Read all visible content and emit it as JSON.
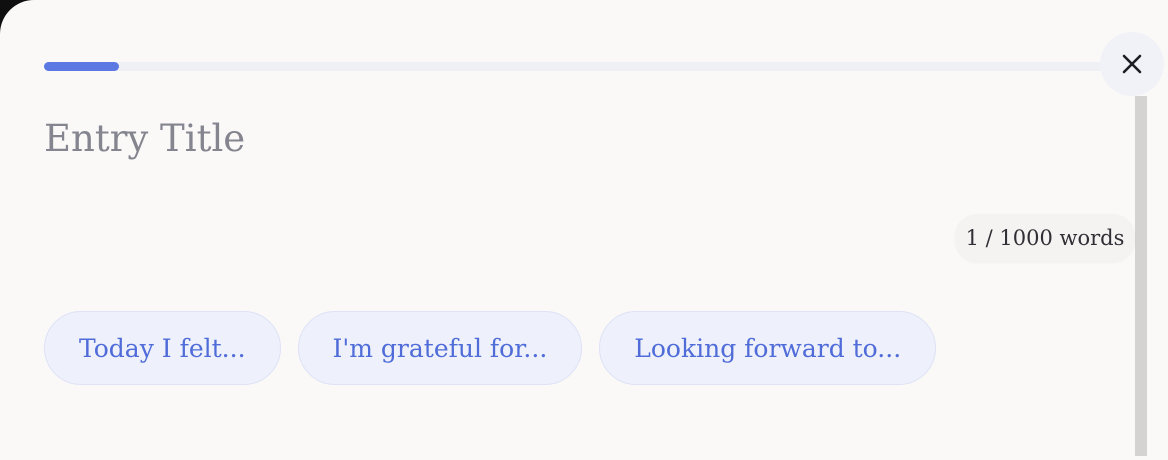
{
  "progress": {
    "fraction": 0.07
  },
  "close_button": {
    "icon": "close-icon",
    "color": "#1d1d22"
  },
  "entry": {
    "title_placeholder": "Entry Title",
    "title_value": ""
  },
  "word_count": {
    "label": "1 / 1000 words"
  },
  "prompts": [
    {
      "label": "Today I felt..."
    },
    {
      "label": "I'm grateful for..."
    },
    {
      "label": "Looking forward to..."
    }
  ],
  "colors": {
    "accent": "#5b78e3",
    "chip_text": "#4f6cd8",
    "chip_bg": "#eef0fb",
    "panel_bg": "#faf9f7"
  }
}
